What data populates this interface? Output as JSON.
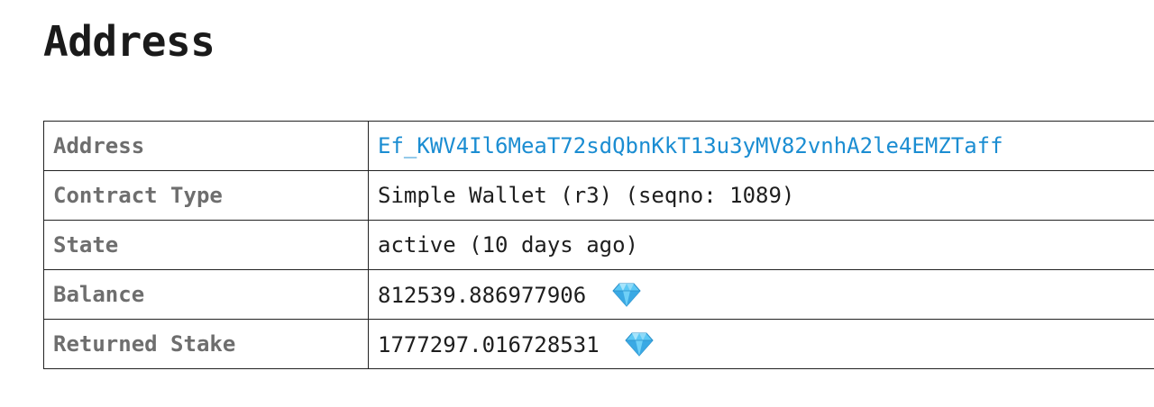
{
  "page": {
    "title": "Address"
  },
  "table": {
    "rows": [
      {
        "label": "Address",
        "value": "Ef_KWV4Il6MeaT72sdQbnKkT13u3yMV82vnhA2le4EMZTaff",
        "is_link": true
      },
      {
        "label": "Contract Type",
        "value": "Simple Wallet (r3) (seqno: 1089)"
      },
      {
        "label": "State",
        "value": "active (10 days ago)"
      },
      {
        "label": "Balance",
        "value": "812539.886977906",
        "icon": "gem-icon"
      },
      {
        "label": "Returned Stake",
        "value": "1777297.016728531",
        "icon": "gem-icon"
      }
    ]
  },
  "colors": {
    "link": "#1b8dd2",
    "label": "#6e6e6e",
    "border": "#222222",
    "gem": "#5bc8f5"
  }
}
